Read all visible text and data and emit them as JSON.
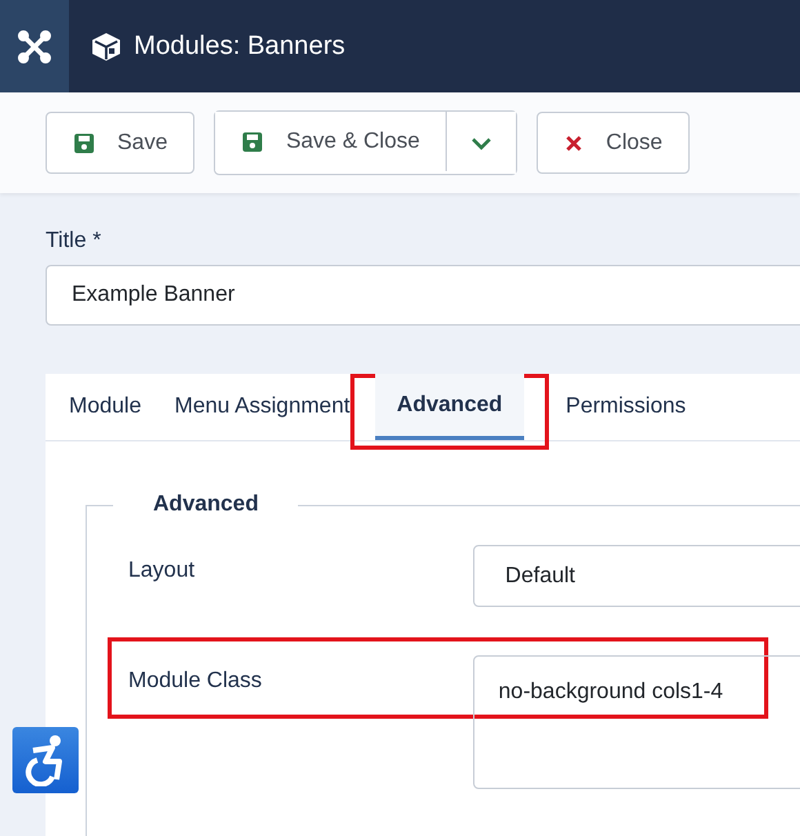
{
  "header": {
    "title": "Modules: Banners"
  },
  "toolbar": [
    {
      "kind": "save",
      "label": "Save"
    },
    {
      "kind": "save-split",
      "label": "Save & Close"
    },
    {
      "kind": "close",
      "label": "Close"
    }
  ],
  "title_field": {
    "label": "Title *",
    "value": "Example Banner"
  },
  "tabs": [
    {
      "label": "Module",
      "selected": false,
      "highlighted": false
    },
    {
      "label": "Menu Assignment",
      "selected": false,
      "highlighted": false
    },
    {
      "label": "Advanced",
      "selected": true,
      "highlighted": true
    },
    {
      "label": "Permissions",
      "selected": false,
      "highlighted": false
    }
  ],
  "fieldset": {
    "legend": "Advanced",
    "fields": [
      {
        "kind": "select",
        "label": "Layout",
        "value": "Default",
        "highlighted": false
      },
      {
        "kind": "textarea",
        "label": "Module Class",
        "value": "no-background cols1-4",
        "highlighted": true
      }
    ]
  }
}
